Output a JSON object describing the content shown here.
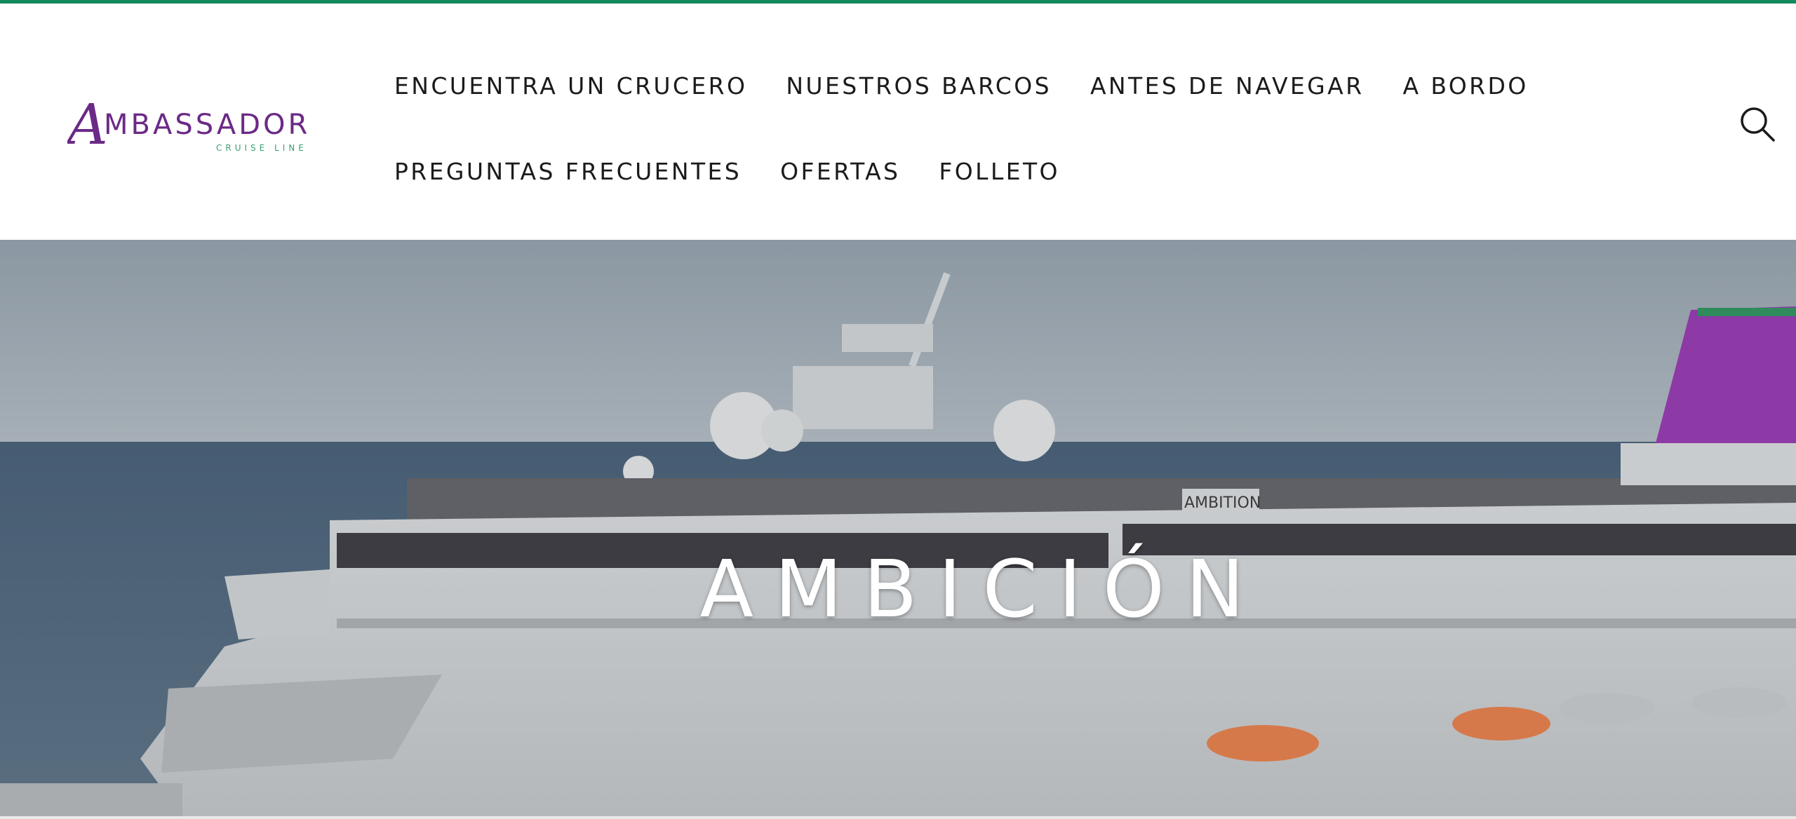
{
  "brand": {
    "name": "AMBASSADOR",
    "tagline": "CRUISE LINE",
    "color_primary": "#6b2a86",
    "color_secondary": "#3aa070"
  },
  "colors": {
    "accent_bar": "#138a5c",
    "nav_text": "#1b1b1b",
    "funnel": "#8d3aa6"
  },
  "nav": {
    "row1": [
      "ENCUENTRA UN CRUCERO",
      "NUESTROS BARCOS",
      "ANTES DE NAVEGAR",
      "A BORDO"
    ],
    "row2": [
      "PREGUNTAS FRECUENTES",
      "OFERTAS",
      "FOLLETO"
    ]
  },
  "search": {
    "icon": "search-icon"
  },
  "hero": {
    "title": "AMBICIÓN",
    "ship_name_plate": "AMBITION"
  }
}
